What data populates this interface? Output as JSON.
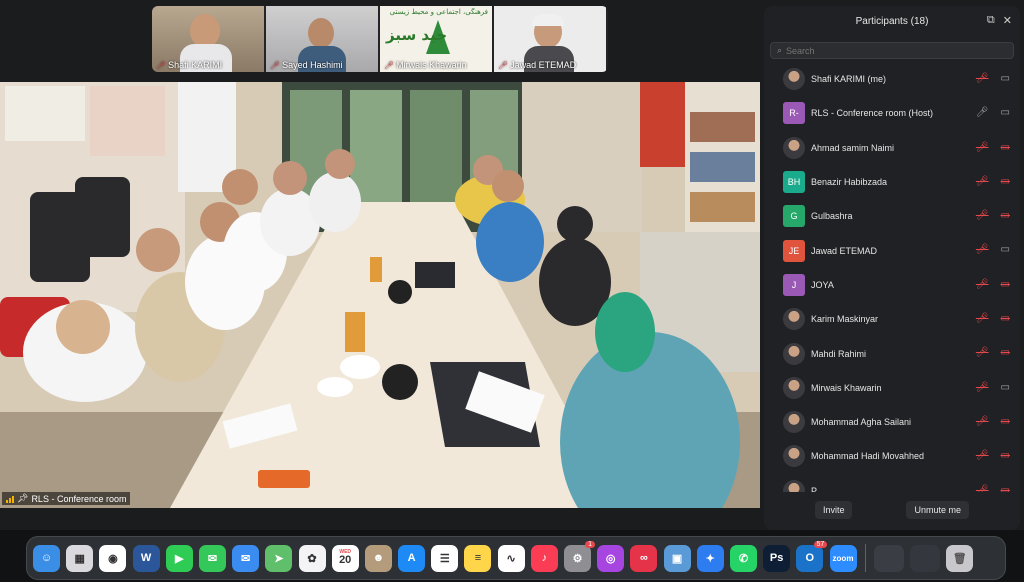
{
  "thumbnails": [
    {
      "name": "Shafi KARIMI",
      "muted": true
    },
    {
      "name": "Sayed Hashimi",
      "muted": true
    },
    {
      "name": "Mirwais Khawarin",
      "muted": true,
      "banner_text": "جید سبز",
      "banner_sub": "فرهنگی، اجتماعی و محیط زیستی"
    },
    {
      "name": "Jawad ETEMAD",
      "muted": true
    }
  ],
  "main_video": {
    "label": "RLS - Conference room"
  },
  "participants_panel": {
    "title": "Participants (18)",
    "search_placeholder": "Search",
    "participants": [
      {
        "name": "Shafi KARIMI (me)",
        "avatar_type": "photo",
        "mic": "muted",
        "video": "on"
      },
      {
        "name": "RLS - Conference room (Host)",
        "avatar_type": "initials",
        "initials": "R-",
        "avatar_color": "#9b59b6",
        "mic": "on",
        "video": "on"
      },
      {
        "name": "Ahmad samim Naimi",
        "avatar_type": "photo",
        "mic": "muted",
        "video": "off"
      },
      {
        "name": "Benazir Habibzada",
        "avatar_type": "initials",
        "initials": "BH",
        "avatar_color": "#1aaa8c",
        "mic": "muted",
        "video": "off"
      },
      {
        "name": "Gulbashra",
        "avatar_type": "initials",
        "initials": "G",
        "avatar_color": "#27a86b",
        "mic": "muted",
        "video": "off"
      },
      {
        "name": "Jawad ETEMAD",
        "avatar_type": "initials",
        "initials": "JE",
        "avatar_color": "#e0533d",
        "mic": "muted",
        "video": "on"
      },
      {
        "name": "JOYA",
        "avatar_type": "initials",
        "initials": "J",
        "avatar_color": "#9b59b6",
        "mic": "muted",
        "video": "off"
      },
      {
        "name": "Karim Maskinyar",
        "avatar_type": "photo",
        "mic": "muted",
        "video": "off"
      },
      {
        "name": "Mahdi Rahimi",
        "avatar_type": "photo",
        "mic": "muted",
        "video": "off"
      },
      {
        "name": "Mirwais Khawarin",
        "avatar_type": "photo",
        "mic": "muted",
        "video": "on"
      },
      {
        "name": "Mohammad Agha Sailani",
        "avatar_type": "photo",
        "mic": "muted",
        "video": "off"
      },
      {
        "name": "Mohammad Hadi Movahhed",
        "avatar_type": "photo",
        "mic": "muted",
        "video": "off"
      },
      {
        "name": "P",
        "avatar_type": "photo",
        "mic": "muted",
        "video": "off"
      }
    ],
    "invite_label": "Invite",
    "unmute_label": "Unmute me"
  },
  "dock": {
    "apps": [
      {
        "name": "Finder",
        "color": "#3a8ee6",
        "glyph": "☺"
      },
      {
        "name": "Launchpad",
        "color": "#d9d9de",
        "glyph": "▦"
      },
      {
        "name": "Chrome",
        "color": "#ffffff",
        "glyph": "◉"
      },
      {
        "name": "Word",
        "color": "#2b579a",
        "glyph": "W"
      },
      {
        "name": "FaceTime",
        "color": "#2ecc55",
        "glyph": "▶"
      },
      {
        "name": "Messages",
        "color": "#34c759",
        "glyph": "✉"
      },
      {
        "name": "Mail",
        "color": "#3b8cf0",
        "glyph": "✉"
      },
      {
        "name": "Maps",
        "color": "#5fbf6a",
        "glyph": "➤"
      },
      {
        "name": "Photos",
        "color": "#f4f4f6",
        "glyph": "✿"
      },
      {
        "name": "Calendar",
        "color": "#ffffff",
        "glyph": "20",
        "sub": "WED"
      },
      {
        "name": "Contacts",
        "color": "#b49b7c",
        "glyph": "☻"
      },
      {
        "name": "App Store",
        "color": "#1e8af5",
        "glyph": "A"
      },
      {
        "name": "Reminders",
        "color": "#ffffff",
        "glyph": "☰"
      },
      {
        "name": "Notes",
        "color": "#ffd54a",
        "glyph": "≡"
      },
      {
        "name": "Freeform",
        "color": "#ffffff",
        "glyph": "∿"
      },
      {
        "name": "Music",
        "color": "#fa3c55",
        "glyph": "♪"
      },
      {
        "name": "System Settings",
        "color": "#8e8e93",
        "glyph": "⚙",
        "badge": "1"
      },
      {
        "name": "Podcasts",
        "color": "#a745e0",
        "glyph": "◎"
      },
      {
        "name": "Creative Cloud",
        "color": "#e5334a",
        "glyph": "∞"
      },
      {
        "name": "Preview",
        "color": "#5a9ad6",
        "glyph": "▣"
      },
      {
        "name": "Safari",
        "color": "#2d7cf0",
        "glyph": "✦"
      },
      {
        "name": "WhatsApp",
        "color": "#25d366",
        "glyph": "✆"
      },
      {
        "name": "Photoshop",
        "color": "#0e1e35",
        "glyph": "Ps"
      },
      {
        "name": "Outlook",
        "color": "#1a73c9",
        "glyph": "O",
        "badge": "57"
      },
      {
        "name": "Zoom",
        "color": "#2d8cff",
        "glyph": "zoom"
      }
    ],
    "recents": [
      {
        "name": "Window preview 1",
        "color": "#3a3d44"
      },
      {
        "name": "Window preview 2",
        "color": "#34373d"
      },
      {
        "name": "Trash",
        "color": "#c8c8cc",
        "glyph": "🗑"
      }
    ]
  }
}
